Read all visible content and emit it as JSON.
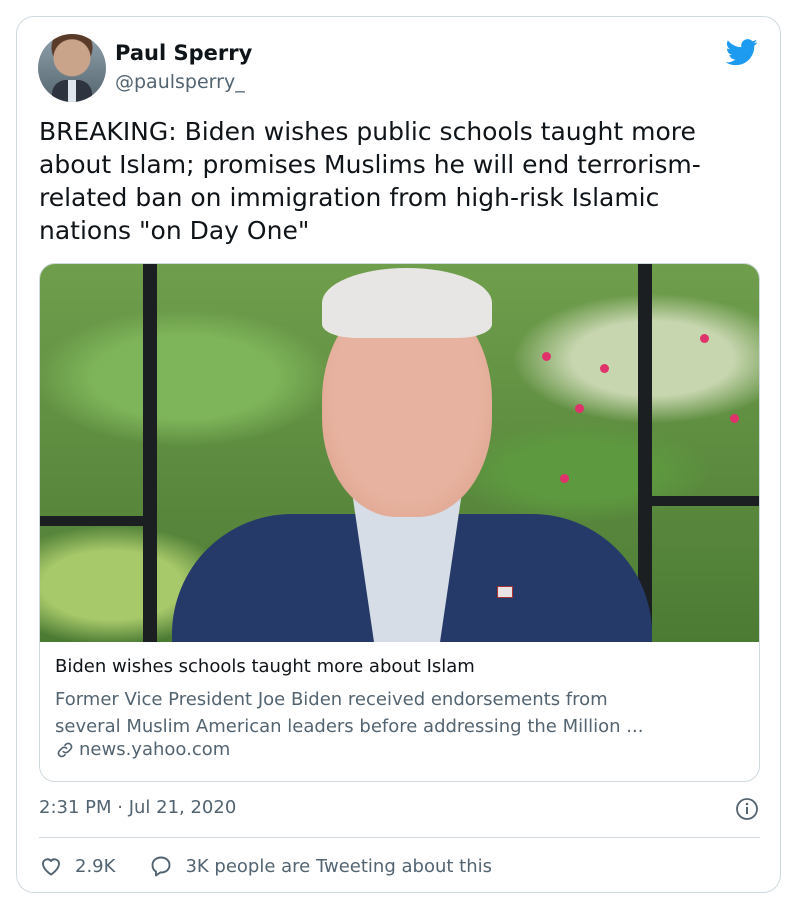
{
  "author": {
    "display_name": "Paul Sperry",
    "handle": "@paulsperry_"
  },
  "tweet": {
    "text": "BREAKING: Biden wishes public schools taught more\nabout Islam; promises Muslims he will end terrorism-\nrelated ban on immigration from high-risk Islamic\nnations \"on Day One\"",
    "timestamp": "2:31 PM · Jul 21, 2020"
  },
  "link_card": {
    "title": "Biden wishes schools taught more about Islam",
    "description_line1": "Former Vice President Joe Biden received endorsements from",
    "description_line2": "several Muslim American leaders before addressing the Million ...",
    "domain": "news.yahoo.com"
  },
  "actions": {
    "likes": "2.9K",
    "conversation": "3K people are Tweeting about this"
  },
  "colors": {
    "brand": "#1d9bf0",
    "text": "#0f1419",
    "muted": "#536471",
    "border": "#cfd9de"
  },
  "icons": {
    "platform": "twitter-bird-icon",
    "link": "link-icon",
    "info": "info-icon",
    "like": "heart-icon",
    "reply": "speech-bubble-icon"
  }
}
